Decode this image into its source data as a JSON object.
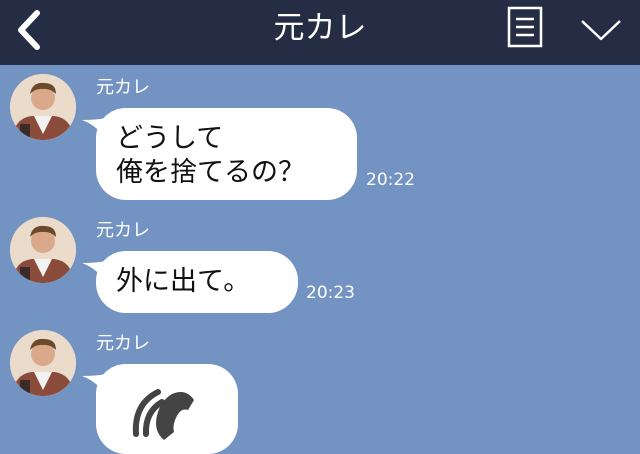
{
  "header": {
    "title": "元カレ",
    "back_icon": "chevron-left-icon",
    "menu_icon": "document-menu-icon",
    "dropdown_icon": "chevron-down-icon"
  },
  "messages": [
    {
      "sender": "元カレ",
      "lines": [
        "どうして",
        "俺を捨てるの？"
      ],
      "time": "20:22"
    },
    {
      "sender": "元カレ",
      "lines": [
        "外に出て。"
      ],
      "time": "20:23"
    },
    {
      "sender": "元カレ",
      "icon": "phone-call-icon"
    }
  ],
  "colors": {
    "header_bg": "#242d43",
    "chat_bg": "#7393c2",
    "bubble_bg": "#ffffff"
  }
}
